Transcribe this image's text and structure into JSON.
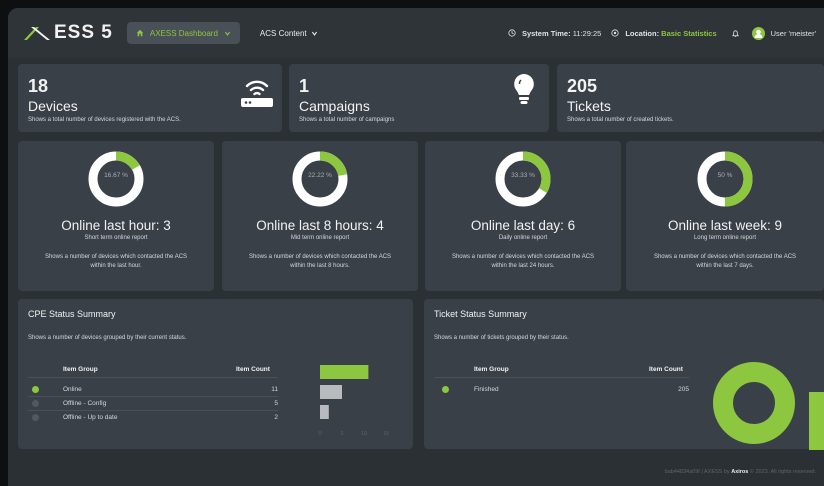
{
  "header": {
    "logo_text": "ESS 5",
    "nav_dashboard": "AXESS Dashboard",
    "nav_content": "ACS Content",
    "system_time_label": "System Time:",
    "system_time_value": "11:29:25",
    "location_label": "Location:",
    "location_value": "Basic Statistics",
    "user_label": "User 'meister'"
  },
  "stats": [
    {
      "value": "18",
      "label": "Devices",
      "desc": "Shows a total number of devices registered with the ACS.",
      "icon": "router-icon"
    },
    {
      "value": "1",
      "label": "Campaigns",
      "desc": "Shows a total number of campaigns",
      "icon": "lightbulb-icon"
    },
    {
      "value": "205",
      "label": "Tickets",
      "desc": "Shows a total number of created tickets.",
      "icon": ""
    }
  ],
  "online": [
    {
      "pct_label": "16.67 %",
      "pct": 16.67,
      "title": "Online last hour: 3",
      "sub": "Short term online report",
      "desc1": "Shows a number of devices which contacted the ACS",
      "desc2": "within the last hour."
    },
    {
      "pct_label": "22.22 %",
      "pct": 22.22,
      "title": "Online last 8 hours: 4",
      "sub": "Mid term online report",
      "desc1": "Shows a number of devices which contacted the ACS",
      "desc2": "within the last 8 hours."
    },
    {
      "pct_label": "33.33 %",
      "pct": 33.33,
      "title": "Online last day: 6",
      "sub": "Daily online report",
      "desc1": "Shows a number of devices which contacted the ACS",
      "desc2": "within the last 24 hours."
    },
    {
      "pct_label": "50 %",
      "pct": 50,
      "title": "Online last week: 9",
      "sub": "Long term online report",
      "desc1": "Shows a number of devices which contacted the ACS",
      "desc2": "within the last 7 days."
    }
  ],
  "cpe": {
    "title": "CPE Status Summary",
    "desc": "Shows a number of devices grouped by their current status.",
    "col_group": "Item Group",
    "col_count": "Item Count",
    "rows": [
      {
        "name": "Online",
        "count": "11",
        "color": "#8dc63f"
      },
      {
        "name": "Offline - Config",
        "count": "5",
        "color": "#52585e"
      },
      {
        "name": "Offline - Up to date",
        "count": "2",
        "color": "#52585e"
      }
    ]
  },
  "chart_data": {
    "type": "bar",
    "orientation": "horizontal",
    "categories": [
      "Online",
      "Offline - Config",
      "Offline - Up to date"
    ],
    "values": [
      11,
      5,
      2
    ],
    "colors": [
      "#8dc63f",
      "#b7bbbe",
      "#b7bbbe"
    ],
    "xlim": [
      0,
      15
    ],
    "xticks": [
      "0",
      "5",
      "10",
      "15"
    ]
  },
  "tickets": {
    "title": "Ticket Status Summary",
    "desc": "Shows a number of tickets grouped by their status.",
    "col_group": "Item Group",
    "col_count": "Item Count",
    "rows": [
      {
        "name": "Finished",
        "count": "205",
        "color": "#8dc63f"
      }
    ]
  },
  "footer": {
    "hash": "bab44834a09f | AXESS by",
    "brand": "Axiros",
    "copy": "© 2023. All rights reserved."
  }
}
